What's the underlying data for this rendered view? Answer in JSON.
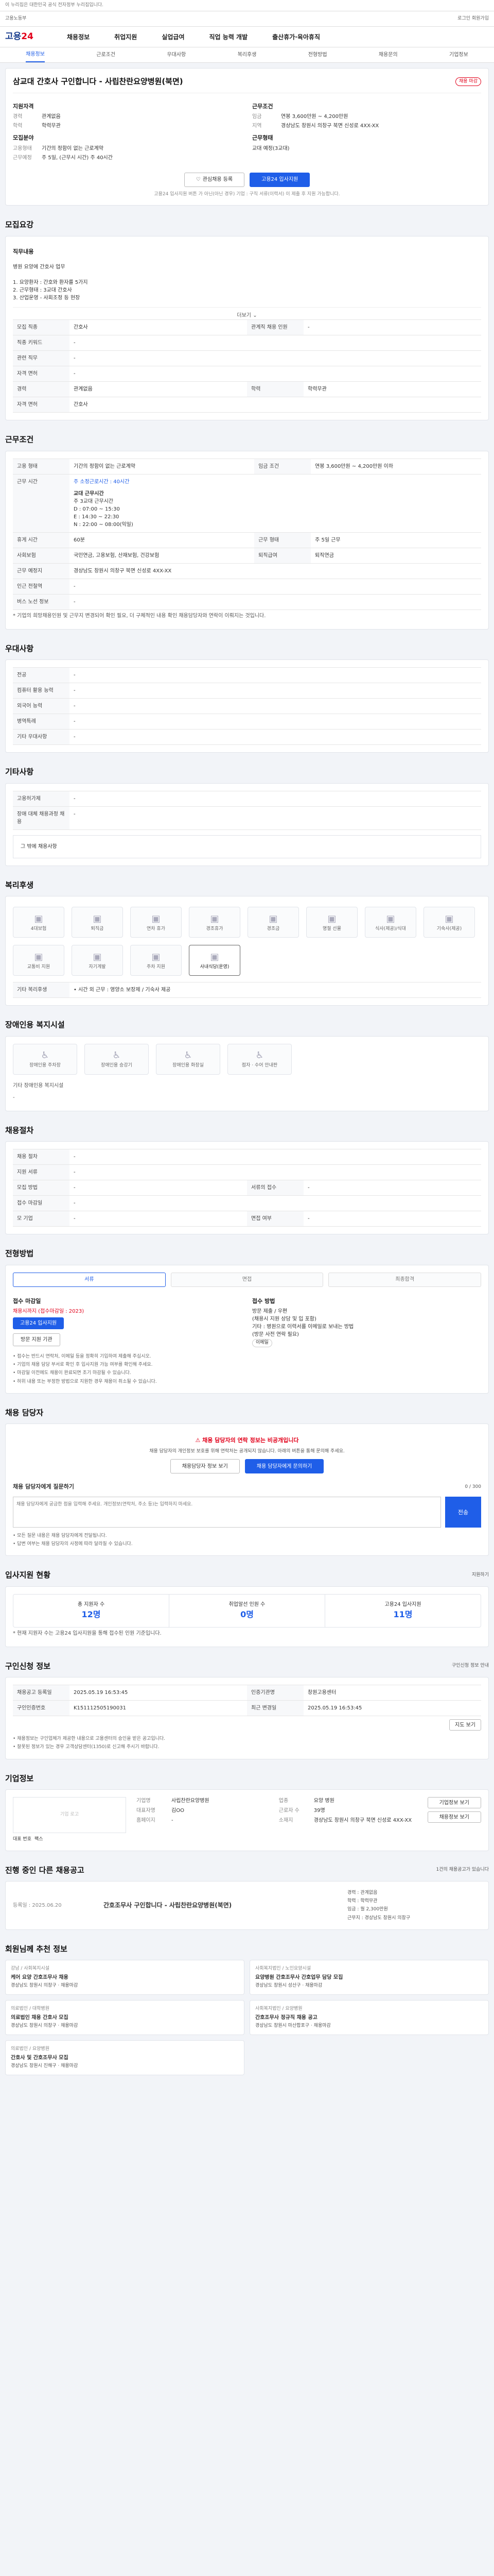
{
  "topbar": {
    "notice": "이 누리집은 대한민국 공식 전자정부 누리집입니다."
  },
  "govbanner": {
    "left": "고용노동부",
    "right": "로그인  회원가입"
  },
  "header": {
    "logo_main": "고용",
    "logo_accent": "24",
    "menu": [
      "채용정보",
      "취업지원",
      "실업급여",
      "직업 능력 개발",
      "출산휴가·육아휴직"
    ]
  },
  "subtabs": [
    "채용정보",
    "근로조건",
    "우대사항",
    "복리후생",
    "전형방법",
    "채용문의",
    "기업정보"
  ],
  "job": {
    "title": "삼교대 간호사 구인합니다 - 사립찬란요양병원(북면)",
    "badge": "채용 마감",
    "company_label": "지원자격",
    "kv_left": [
      {
        "k": "경력",
        "v": "관계없음"
      },
      {
        "k": "학력",
        "v": "학력무관"
      }
    ],
    "edu_label": "모집분야",
    "kv_left2": [
      {
        "k": "고용형태",
        "v": "기간의 정함이 없는 근로계약"
      },
      {
        "k": "근무예정",
        "v": "주 5일, (근무시 시간) 주 40시간"
      }
    ],
    "cond_label": "근무조건",
    "kv_right": [
      {
        "k": "임금",
        "v": "연봉 3,600만원 ~ 4,200만원"
      },
      {
        "k": "지역",
        "v": "경상남도 창원시 의창구 북면 신성로 4XX-XX"
      }
    ],
    "type_label": "근무형태",
    "kv_right2": [
      {
        "k": "",
        "v": "교대 예정(3교대)"
      }
    ],
    "btn_save": "관심채용 등록",
    "btn_apply": "고용24 입사지원",
    "note": "고용24 입사지원 버튼 가 아닌(아닌 경우) 기업 : 구직 서류(이력서) 이 제출 후 지원 가능합니다."
  },
  "recruit": {
    "head": "모집요강",
    "desc_label": "직무내용",
    "desc": "병원 요양에 간호사 업무\n\n1. 요양환자 : 간호와 환자를 5가지\n2. 근무형태 : 3교대 간호사\n3. 산업운영 - 사회조정 등 현장",
    "more": "더보기",
    "rows": [
      {
        "k1": "모집 직종",
        "v1": "간호사",
        "k2": "관계직 채용 인원",
        "v2": "-"
      },
      {
        "k1": "직종 키워드",
        "v1": "-",
        "k2": "",
        "v2": ""
      },
      {
        "k1": "관련 직무",
        "v1": "-",
        "k2": "",
        "v2": ""
      },
      {
        "k1": "자격 면허",
        "v1": "-",
        "k2": "",
        "v2": ""
      },
      {
        "k1": "경력",
        "v1": "관계없음",
        "k2": "학력",
        "v2": "학력무관"
      },
      {
        "k1": "자격 면허",
        "v1": "간호사",
        "k2": "",
        "v2": ""
      }
    ]
  },
  "work": {
    "head": "근무조건",
    "rows1": [
      {
        "k1": "고용 형태",
        "v1": "기간의 정함이 없는 근로계약",
        "k2": "임금 조건",
        "v2": "연봉 3,600만원 ~ 4,200만원 이하"
      }
    ],
    "time_label": "근무 시간",
    "time_value": "주 소정근로시간 : 40시간",
    "shift_title": "교대 근무시간",
    "shifts": [
      "주 3교대 근무시간",
      "D : 07:00 ~ 15:30",
      "E : 14:30 ~ 22:30",
      "N : 22:00 ~ 08:00(익일)"
    ],
    "rows2": [
      {
        "k1": "휴게 시간",
        "v1": "60분",
        "k2": "근무 형태",
        "v2": "주 5일 근무"
      },
      {
        "k1": "사회보험",
        "v1": "국민연금, 고용보험, 산재보험, 건강보험",
        "k2": "퇴직급여",
        "v2": "퇴직연금"
      },
      {
        "k1": "근무 예정지",
        "v1": "경상남도 창원시 의창구 북면 신성로 4XX-XX",
        "k2": "",
        "v2": ""
      },
      {
        "k1": "인근 전철역",
        "v1": "-",
        "k2": "",
        "v2": ""
      },
      {
        "k1": "버스 노선 정보",
        "v1": "-",
        "k2": "",
        "v2": ""
      }
    ],
    "map_btn": "지도 보기",
    "note": "* 기업의 희망채용인원 및 근무지 변경되어 확인 필요, 더 구체적인 내용 확인 채용담당자와 연락이 이뤄지는 것입니다."
  },
  "prefer": {
    "head": "우대사항",
    "rows": [
      {
        "k": "전공",
        "v": "-"
      },
      {
        "k": "컴퓨터 활용 능력",
        "v": "-"
      },
      {
        "k": "외국어 능력",
        "v": "-"
      },
      {
        "k": "병역특례",
        "v": "-"
      },
      {
        "k": "기타 우대사항",
        "v": "-"
      }
    ]
  },
  "extra": {
    "head": "기타사항",
    "rows": [
      {
        "k": "고용허가제",
        "v": "-"
      },
      {
        "k": "장애 대체 채용과정 채용",
        "v": "-"
      }
    ],
    "file_label": "그 밖에 채용사항"
  },
  "welfare": {
    "head": "복리후생",
    "items": [
      "4대보험",
      "퇴직금",
      "연차 휴가",
      "경조휴가",
      "경조금",
      "명절 선물",
      "식사(제공)/식대",
      "기숙사(제공)",
      "교통비 지원",
      "자기계발",
      "주차 지원",
      "사내식당(운영)"
    ],
    "other_label": "기타 복리후생",
    "other_value": "• 시간 외 근무 : 영양소 보장제 / 기숙사 제공"
  },
  "facility": {
    "head": "장애인용 복지시설",
    "items": [
      "장애인용 주차장",
      "장애인용 승강기",
      "장애인용 화장실",
      "점자 · 수어 안내판"
    ],
    "other_label": "기타 장애인용 복지시설",
    "other_value": "-"
  },
  "hire": {
    "head": "채용절차",
    "rows": [
      {
        "k1": "채용 절차",
        "v1": "-",
        "k2": "",
        "v2": ""
      },
      {
        "k1": "지원 서류",
        "v1": "-",
        "k2": "",
        "v2": ""
      },
      {
        "k1": "모집 방법",
        "v1": "-",
        "k2": "서류의 접수",
        "v2": "-"
      },
      {
        "k1": "접수 마감일",
        "v1": "-",
        "k2": "",
        "v2": ""
      },
      {
        "k1": "모 기업",
        "v1": "-",
        "k2": "면접 여부",
        "v2": "-"
      }
    ]
  },
  "method": {
    "head": "전형방법",
    "steps": [
      "서류",
      "면접",
      "최종합격"
    ],
    "col1_title": "접수 마감일",
    "col1_value": "채용시까지 (접수마감일 : 2023)",
    "col1_btn": "고용24 입사지원",
    "col1_btn2": "방문 지원 기관",
    "col2_title": "접수 방법",
    "col2_lines": [
      "방문 제출 / 우편",
      "(채용시 지원 상담 및 입 포함)",
      "기타 : 병원으로 이력서를 이메일로 보내는 방법",
      "(방문 사전 연락 필요)"
    ],
    "col2_tag": "이메일",
    "bullets": "• 접수는 반드시 연락처, 이메일 등을 정확히 기입하여 제출해 주십시오.\n• 기업의 채용 담당 부서로 확인 후 입사지원 가능 여부를 확인해 주세요.\n• 마감일 이전에도 채용이 완료되면 조기 마감될 수 있습니다.\n• 허위 내용 또는 부정한 방법으로 지원한 경우 채용이 취소될 수 있습니다."
  },
  "contact": {
    "head": "채용 담당자",
    "alert_title": "채용 담당자의 연락 정보는 비공개입니다",
    "alert_desc": "채용 담당자의 개인정보 보호를 위해 연락처는 공개되지 않습니다. 아래의 버튼을 통해 문의해 주세요.",
    "btn1": "채용담당자 정보 보기",
    "btn2": "채용 담당자에게 문의하기",
    "q_label": "채용 담당자에게 질문하기",
    "q_count": "0 / 300",
    "q_placeholder": "채용 담당자에게 궁금한 점을 입력해 주세요. 개인정보(연락처, 주소 등)는 입력하지 마세요.",
    "q_btn": "전송",
    "q_notes": "• 모든 질문 내용은 채용 담당자에게 전달됩니다.\n• 답변 여부는 채용 담당자의 사정에 따라 달라질 수 있습니다."
  },
  "status": {
    "head": "입사지원 현황",
    "link": "지원하기",
    "items": [
      {
        "label": "총 지원자 수",
        "value": "12명"
      },
      {
        "label": "취업알선 인원 수",
        "value": "0명"
      },
      {
        "label": "고용24 입사지원",
        "value": "11명"
      }
    ],
    "note": "* 현재 지원자 수는 고용24 입사지원을 통해 접수된 인원 기준입니다."
  },
  "info": {
    "head": "구인신청 정보",
    "link": "구인신청 정보 안내",
    "rows": [
      {
        "k1": "채용공고 등록일",
        "v1": "2025.05.19 16:53:45",
        "k2": "인증기관명",
        "v2": "창원고용센터"
      },
      {
        "k1": "구인인증번호",
        "v1": "K151112505190031",
        "k2": "최근 변경일",
        "v2": "2025.05.19 16:53:45"
      }
    ],
    "btn": "지도 보기",
    "notes": "• 채용정보는 구인업체가 제공한 내용으로 고용센터의 승인을 받은 공고입니다.\n• 잘못된 정보가 있는 경우 고객상담센터(1350)로 신고해 주시기 바랍니다."
  },
  "corp": {
    "head": "기업정보",
    "logo_text": "기업 로고",
    "k": [
      "기업명",
      "업종",
      "대표자명",
      "근로자 수",
      "홈페이지",
      "소재지"
    ],
    "v": [
      "사립찬란요양병원",
      "요양 병원",
      "김OO",
      "39명",
      "-",
      "경상남도 창원시 의창구 북면 신성로 4XX-XX"
    ],
    "btn1": "기업정보 보기",
    "btn2": "채용정보 보기",
    "small": [
      "대표 번호",
      "팩스"
    ]
  },
  "related": {
    "head": "진행 중인 다른 채용공고",
    "link": "1건의 채용공고가 있습니다",
    "date": "등록일 : 2025.06.20",
    "title": "간호조무사 구인합니다 - 사립찬란요양병원(북면)",
    "lines": [
      "경력 : 관계없음",
      "학력 : 학력무관",
      "임금 : 월 2,300만원",
      "근무지 : 경상남도 창원시 의창구"
    ]
  },
  "recs": {
    "head": "회원님께 추천 정보",
    "items": [
      {
        "c": "강남 / 사회복지시설",
        "t": "케어 요양 간호조무사 채용",
        "m": "경상남도 창원시 의창구  ·  채용마감"
      },
      {
        "c": "사회복지법인 / 노인요양시설",
        "t": "요양병원 간호조무사 간호업무 담당 모집",
        "m": "경상남도 창원시 성산구  ·  채용마감"
      },
      {
        "c": "의료법인 / 대학병원",
        "t": "의료법인 채용 간호사 모집",
        "m": "경상남도 창원시 의창구  ·  채용마감"
      },
      {
        "c": "사회복지법인 / 요양병원",
        "t": "간호조무사 정규직 채용 공고",
        "m": "경상남도 창원시 마산합포구  ·  채용마감"
      },
      {
        "c": "의료법인 / 요양병원",
        "t": "간호사 및 간호조무사 모집",
        "m": "경상남도 창원시 진해구  ·  채용마감"
      }
    ]
  }
}
